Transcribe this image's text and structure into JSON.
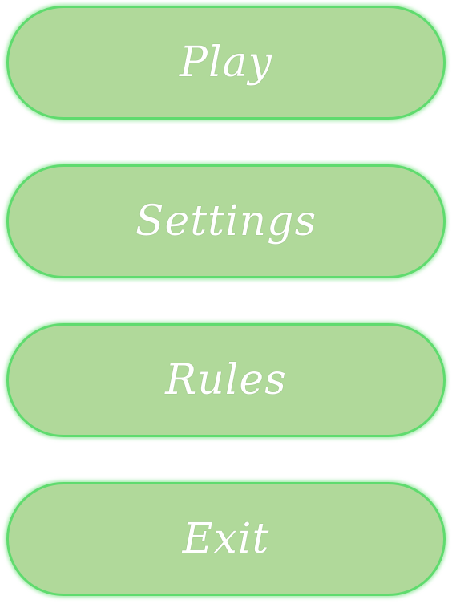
{
  "main_menu": {
    "play_label": "Play",
    "settings_label": "Settings",
    "rules_label": "Rules",
    "exit_label": "Exit"
  },
  "colors": {
    "button_fill": "#b0d99a",
    "button_border": "#5fdb6e",
    "label_text": "#ffffff",
    "background": "#ffffff"
  }
}
